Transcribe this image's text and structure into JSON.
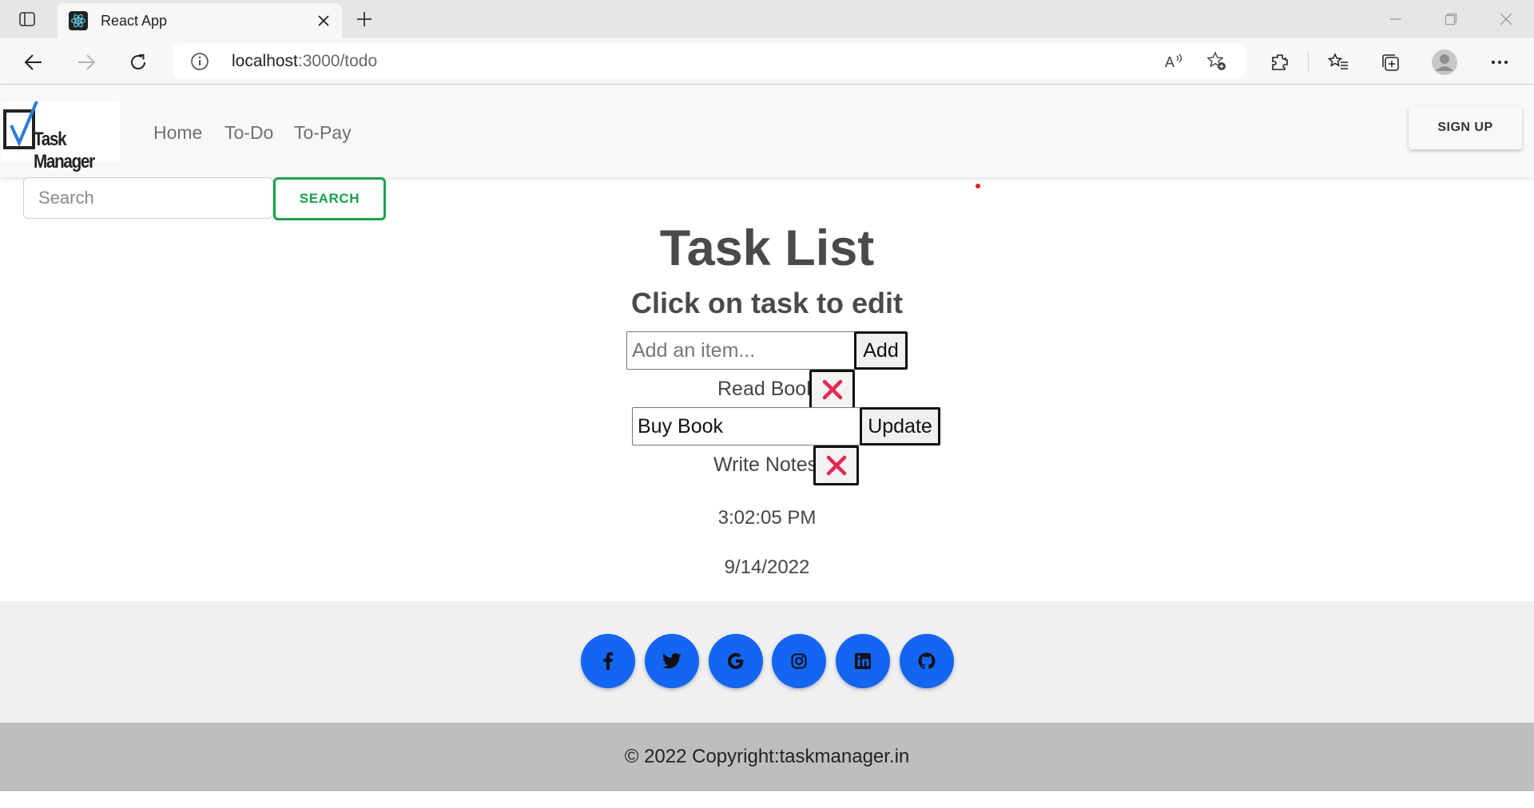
{
  "browser": {
    "tab_title": "React App",
    "url_host": "localhost",
    "url_path": ":3000/todo",
    "icons": [
      "tab-actions-icon",
      "react-favicon-icon",
      "close-tab-icon",
      "new-tab-icon",
      "minimize-icon",
      "restore-icon",
      "close-window-icon",
      "back-icon",
      "forward-icon",
      "refresh-icon",
      "site-info-icon",
      "read-aloud-icon",
      "add-favorite-icon",
      "extensions-icon",
      "favorites-icon",
      "collections-icon",
      "profile-icon",
      "more-icon"
    ]
  },
  "navbar": {
    "logo_text": "Task Manager",
    "links": [
      "Home",
      "To-Do",
      "To-Pay"
    ],
    "signup_label": "SIGN UP"
  },
  "search": {
    "placeholder": "Search",
    "button_label": "SEARCH"
  },
  "main": {
    "title": "Task List",
    "subtitle": "Click on task to edit",
    "add_placeholder": "Add an item...",
    "add_label": "Add",
    "tasks": [
      {
        "label": "Read Book",
        "state": "view"
      },
      {
        "label": "Buy Book",
        "state": "editing",
        "action_label": "Update"
      },
      {
        "label": "Write Notes",
        "state": "view"
      }
    ],
    "time": "3:02:05 PM",
    "date": "9/14/2022"
  },
  "footer": {
    "social_icons": [
      "facebook-icon",
      "twitter-icon",
      "google-icon",
      "instagram-icon",
      "linkedin-icon",
      "github-icon"
    ],
    "copyright": "© 2022 Copyright:taskmanager.in"
  },
  "colors": {
    "accent_green": "#14a44d",
    "social_blue": "#1266f1",
    "delete_red": "#e8264f",
    "footer_bar": "#bebebe"
  }
}
